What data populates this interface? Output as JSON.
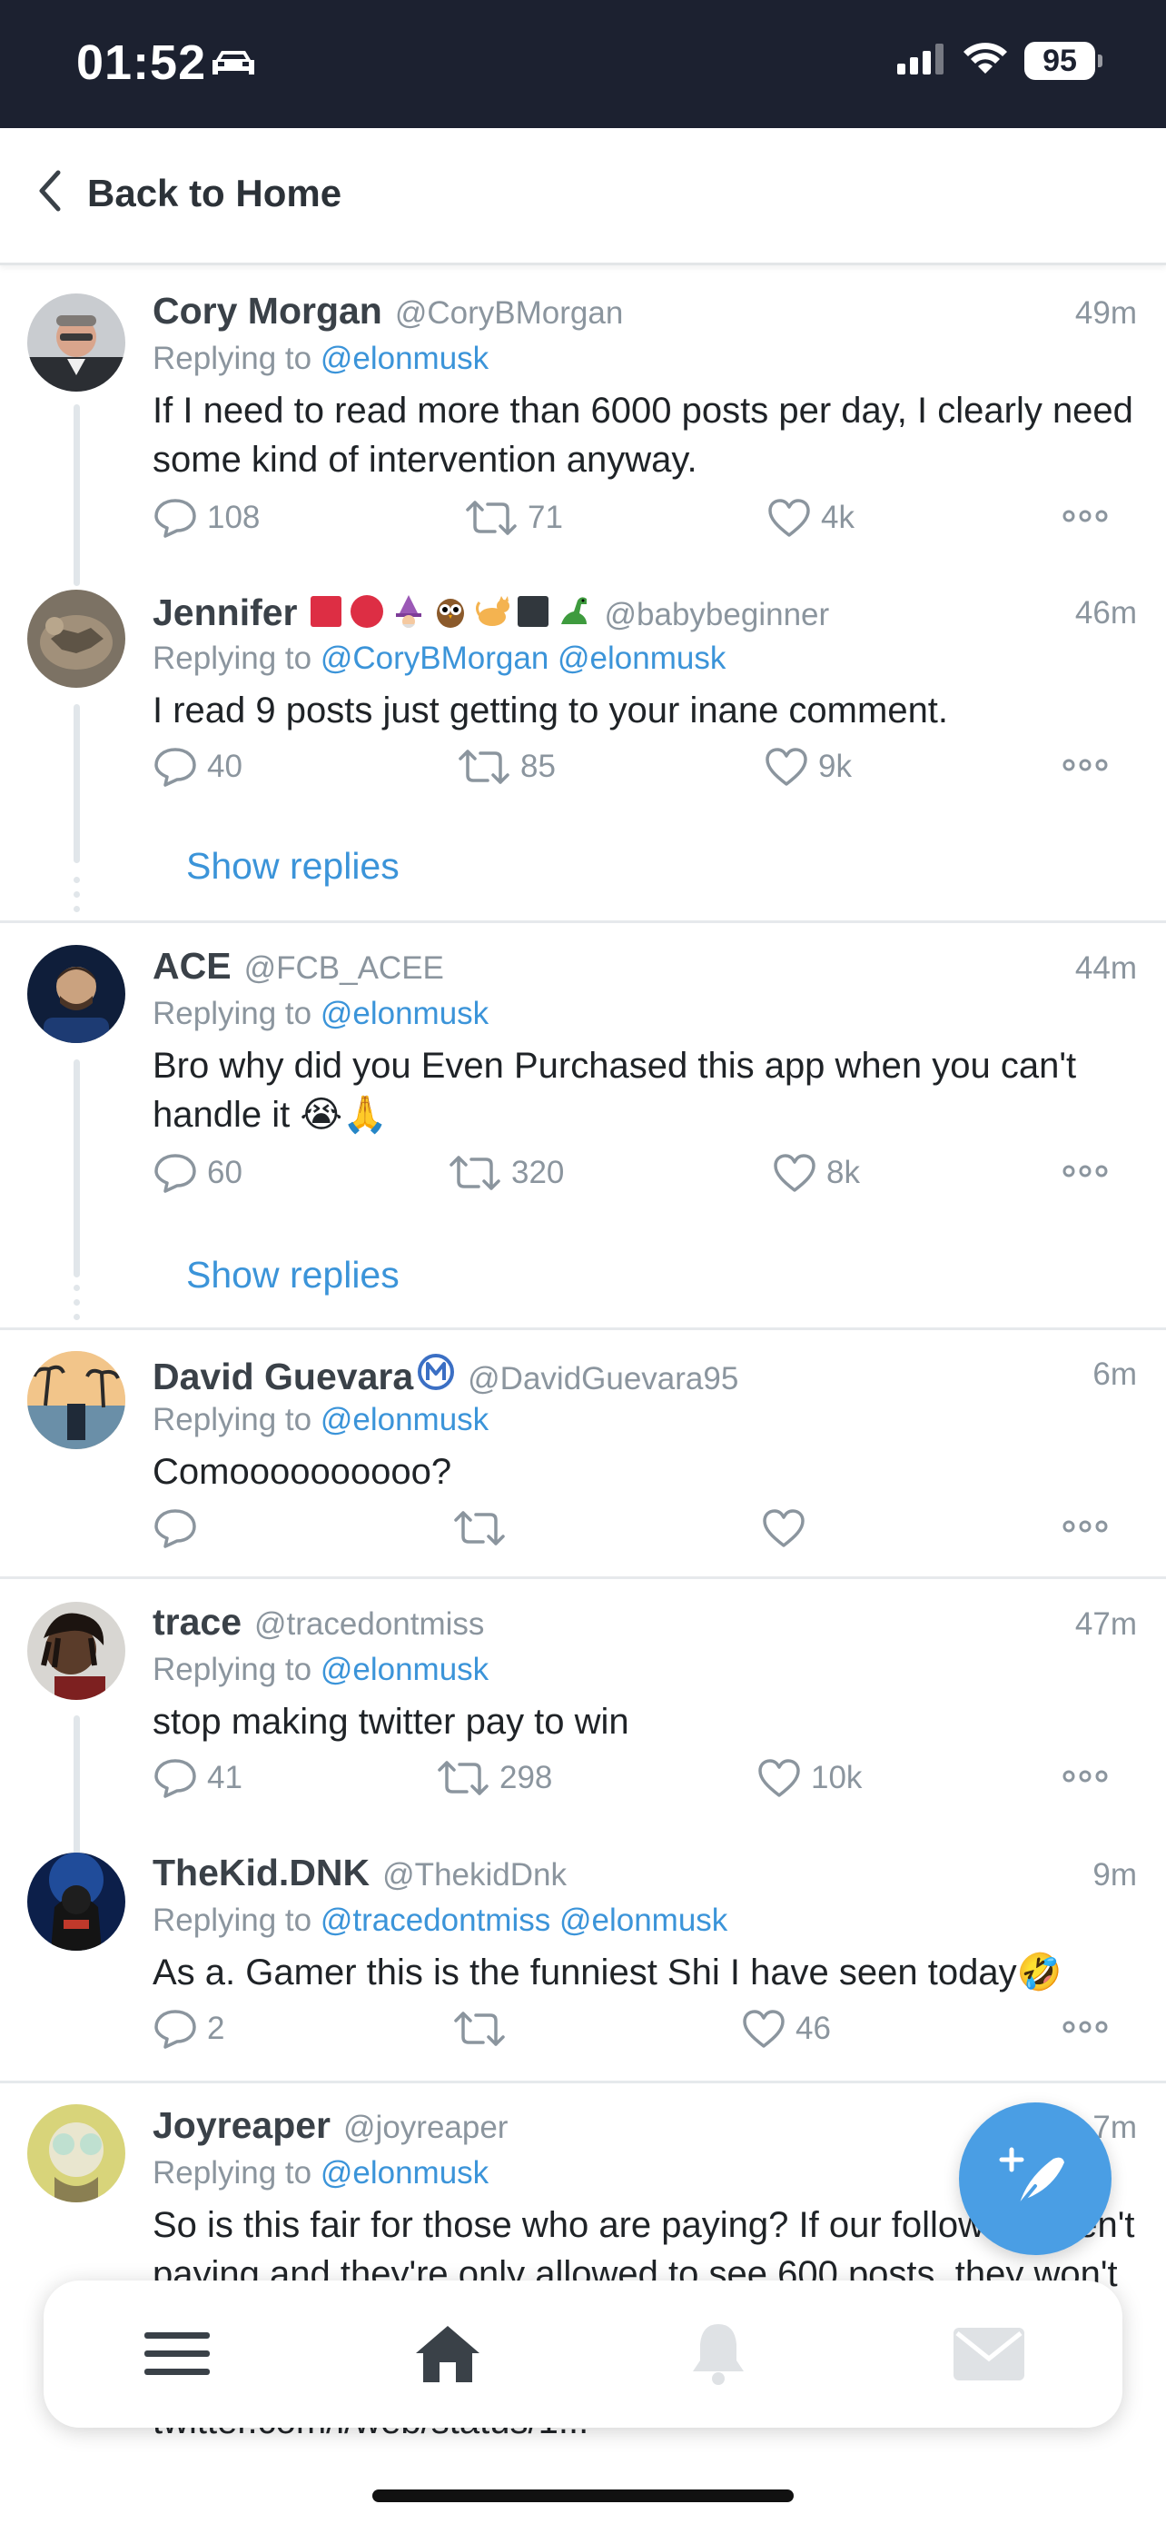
{
  "status_bar": {
    "time": "01:52",
    "battery": "95"
  },
  "header": {
    "back_label": "Back to Home"
  },
  "replying_prefix": "Replying to",
  "tweets": [
    {
      "name": "Cory Morgan",
      "handle": "@CoryBMorgan",
      "time": "49m",
      "reply_to": [
        "@elonmusk"
      ],
      "text": "If I need to read more than 6000 posts per day, I clearly need some kind of intervention anyway.",
      "replies": "108",
      "retweets": "71",
      "likes": "4k"
    },
    {
      "name": "Jennifer",
      "handle": "@babybeginner",
      "time": "46m",
      "name_emojis": [
        "red-square",
        "red-circle",
        "wizard",
        "owl",
        "cat",
        "black-square",
        "dinosaur"
      ],
      "reply_to": [
        "@CoryBMorgan",
        "@elonmusk"
      ],
      "text": "I read 9 posts just getting to your inane comment.",
      "replies": "40",
      "retweets": "85",
      "likes": "9k",
      "show_replies": "Show replies"
    },
    {
      "name": "ACE",
      "handle": "@FCB_ACEE",
      "time": "44m",
      "reply_to": [
        "@elonmusk"
      ],
      "text": "Bro why did you Even Purchased this app when you can't handle it 😭🙏",
      "replies": "60",
      "retweets": "320",
      "likes": "8k",
      "show_replies": "Show replies"
    },
    {
      "name": "David Guevara",
      "handle": "@DavidGuevara95",
      "time": "6m",
      "badge": "Ⓜ",
      "reply_to": [
        "@elonmusk"
      ],
      "text": "Comoooooooooo?",
      "replies": "",
      "retweets": "",
      "likes": ""
    },
    {
      "name": "trace",
      "handle": "@tracedontmiss",
      "time": "47m",
      "reply_to": [
        "@elonmusk"
      ],
      "text": "stop making twitter pay to win",
      "replies": "41",
      "retweets": "298",
      "likes": "10k"
    },
    {
      "name": "TheKid.DNK",
      "handle": "@ThekidDnk",
      "time": "9m",
      "reply_to": [
        "@tracedontmiss",
        "@elonmusk"
      ],
      "text": "As a. Gamer this is the funniest Shi I have seen today🤣",
      "replies": "2",
      "retweets": "",
      "likes": "46"
    },
    {
      "name": "Joyreaper",
      "handle": "@joyreaper",
      "time": "7m",
      "reply_to": [
        "@elonmusk"
      ],
      "text": "So is this fair for those who are paying?  If our followers aren't paying and they're only allowed to see 600 posts, they won't be seeing most of our posts since they are at the top.  If they can't read or engage in posts you are... twitter.com/i/web/status/1...",
      "replies": "",
      "retweets": "",
      "likes": ""
    }
  ],
  "tabbar": {
    "items": [
      "menu-icon",
      "home-icon",
      "bell-icon",
      "mail-icon"
    ]
  },
  "colors": {
    "accent": "#3b94d9",
    "status_bar": "#1c2130",
    "fab": "#4a9ee4"
  }
}
